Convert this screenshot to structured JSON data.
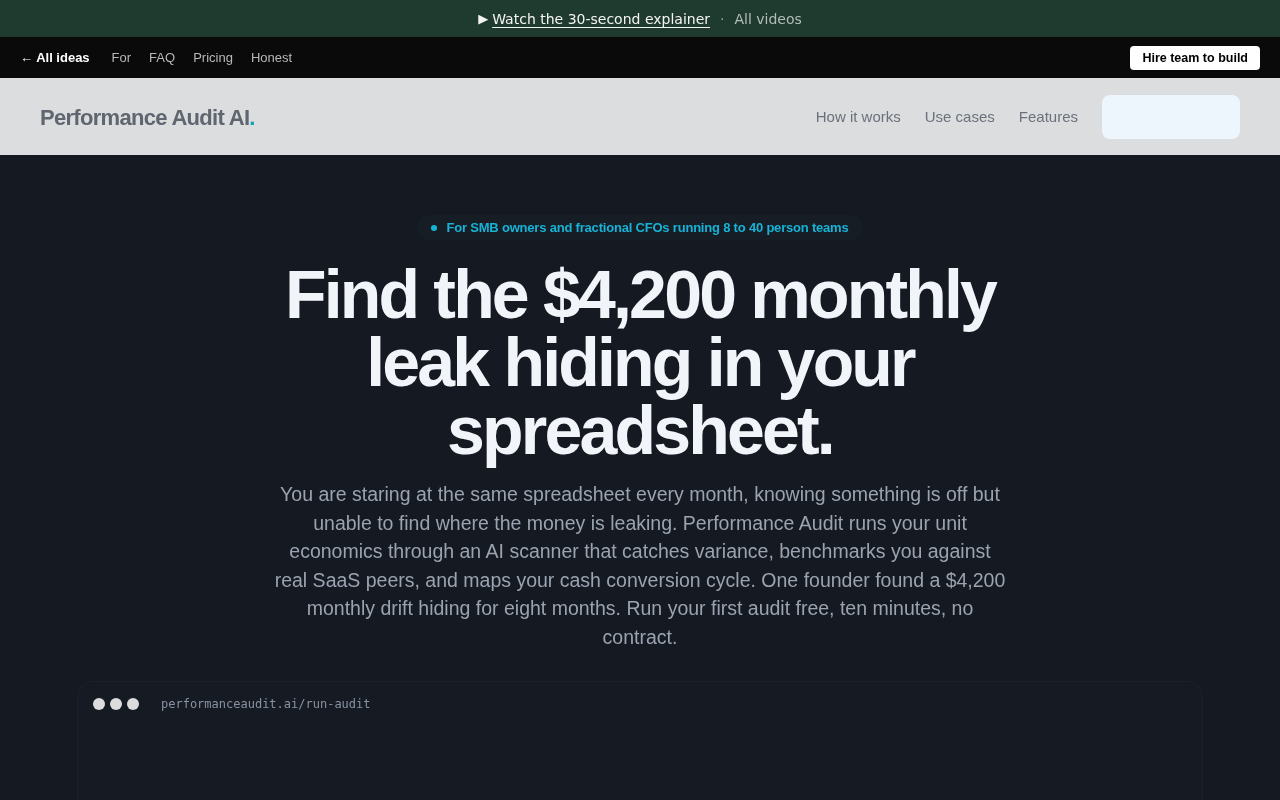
{
  "announcement": {
    "icon": "▶",
    "link": "Watch the 30-second explainer",
    "separator": "·",
    "secondary": "All videos"
  },
  "top_nav": {
    "back_link": "← All ideas",
    "links": [
      "For",
      "FAQ",
      "Pricing",
      "Honest"
    ],
    "button": "Hire team to build"
  },
  "header": {
    "logo": {
      "name": "Performance Audit AI",
      "accent": "."
    },
    "links": [
      "How it works",
      "Use cases",
      "Features"
    ]
  },
  "hero": {
    "badge": "For SMB owners and fractional CFOs running 8 to 40 person teams",
    "title": "Find the $4,200 monthly leak hiding in your spreadsheet.",
    "description": "You are staring at the same spreadsheet every month, knowing something is off but unable to find where the money is leaking. Performance Audit runs your unit economics through an AI scanner that catches variance, benchmarks you against real SaaS peers, and maps your cash conversion cycle. One founder found a $4,200 monthly drift hiding for eight months. Run your first audit free, ten minutes, no contract."
  },
  "preview_window": {
    "url": "performanceaudit.ai/run-audit"
  }
}
